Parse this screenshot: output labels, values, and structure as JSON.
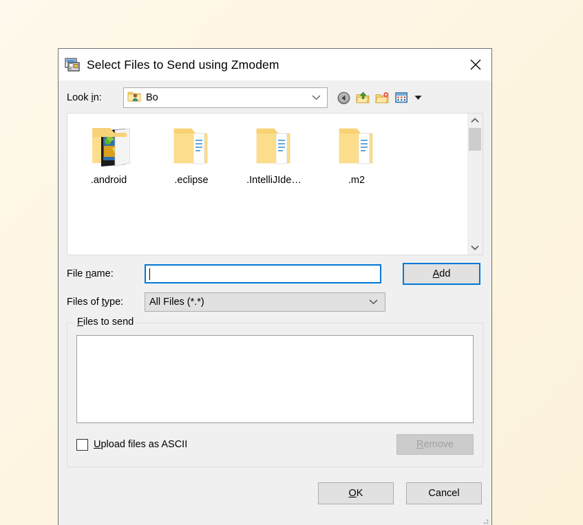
{
  "window": {
    "title": "Select Files to Send using Zmodem",
    "title_icon": "terminal-window-icon",
    "close_icon": "close-icon"
  },
  "lookin": {
    "label_pre": "Look ",
    "label_accel": "i",
    "label_post": "n:",
    "value": "Bo",
    "value_icon": "user-folder-icon",
    "dropdown_icon": "chevron-down-icon",
    "toolbar": [
      {
        "name": "back-button",
        "icon": "back-arrow-icon",
        "tooltip": "Back"
      },
      {
        "name": "up-one-level-button",
        "icon": "up-folder-icon",
        "tooltip": "Up One Level"
      },
      {
        "name": "new-folder-button",
        "icon": "new-folder-icon",
        "tooltip": "Create New Folder"
      },
      {
        "name": "view-menu-button",
        "icon": "view-grid-icon",
        "tooltip": "View Menu"
      }
    ],
    "toolbar_caret_icon": "caret-down-icon"
  },
  "files": {
    "items": [
      {
        "name": ".android",
        "icon": "folder-android-icon"
      },
      {
        "name": ".eclipse",
        "icon": "folder-documents-icon"
      },
      {
        "name": ".IntelliJIde…",
        "icon": "folder-documents-icon"
      },
      {
        "name": ".m2",
        "icon": "folder-documents-icon"
      },
      {
        "name": "",
        "icon": "folder-clipped-light-icon"
      },
      {
        "name": "",
        "icon": "folder-clipped-dark-icon"
      },
      {
        "name": "",
        "icon": "folder-clipped-plain-icon"
      },
      {
        "name": "",
        "icon": "folder-clipped-empty-icon"
      }
    ],
    "scrollbar": {
      "up_icon": "chevron-up-icon",
      "down_icon": "chevron-down-icon",
      "thumb": "scroll-thumb"
    }
  },
  "form": {
    "filename_label_pre": "File ",
    "filename_label_accel": "n",
    "filename_label_post": "ame:",
    "filename_value": "",
    "filename_placeholder": "",
    "filetype_label_pre": "Files of ",
    "filetype_label_accel": "t",
    "filetype_label_post": "ype:",
    "filetype_value": "All Files (*.*)",
    "filetype_dropdown_icon": "chevron-down-icon",
    "add_label_accel": "A",
    "add_label_post": "dd"
  },
  "group": {
    "legend_accel": "F",
    "legend_post": "iles to send",
    "list_items": [],
    "checkbox_label_accel": "U",
    "checkbox_label_post": "pload files as ASCII",
    "checkbox_checked": false,
    "remove_label_accel": "R",
    "remove_label_post": "emove",
    "remove_enabled": false
  },
  "footer": {
    "ok_accel": "O",
    "ok_post": "K",
    "cancel_label": "Cancel"
  },
  "colors": {
    "desktop_bg": "#FDF6E3",
    "dialog_bg": "#F0F0F0",
    "accent": "#0078D7",
    "folder_yellow": "#FCDC8B",
    "disabled_text": "#A0A0A0"
  }
}
